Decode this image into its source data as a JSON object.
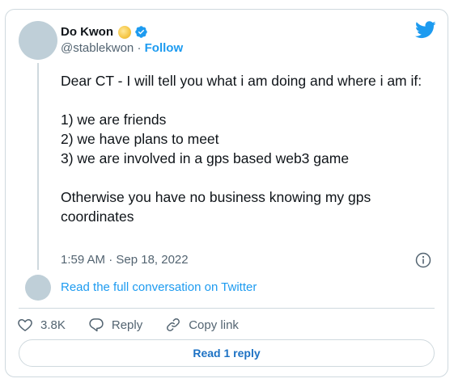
{
  "author": {
    "display_name": "Do Kwon",
    "handle": "@stablekwon",
    "separator": " · ",
    "follow_label": "Follow"
  },
  "tweet": {
    "lines": [
      "Dear CT - I will tell you what i am doing and where i am if:",
      "1) we are friends",
      "2) we have plans to meet",
      "3) we are involved in a gps based web3 game",
      "Otherwise you have no business knowing my gps coordinates"
    ],
    "timestamp": "1:59 AM · Sep 18, 2022"
  },
  "conversation_link": "Read the full conversation on Twitter",
  "actions": {
    "likes": "3.8K",
    "reply_label": "Reply",
    "copy_link_label": "Copy link"
  },
  "read_reply_label": "Read 1 reply",
  "colors": {
    "accent": "#1d9bf0",
    "text": "#0f1419",
    "muted": "#536471",
    "border": "#cfd9de"
  }
}
